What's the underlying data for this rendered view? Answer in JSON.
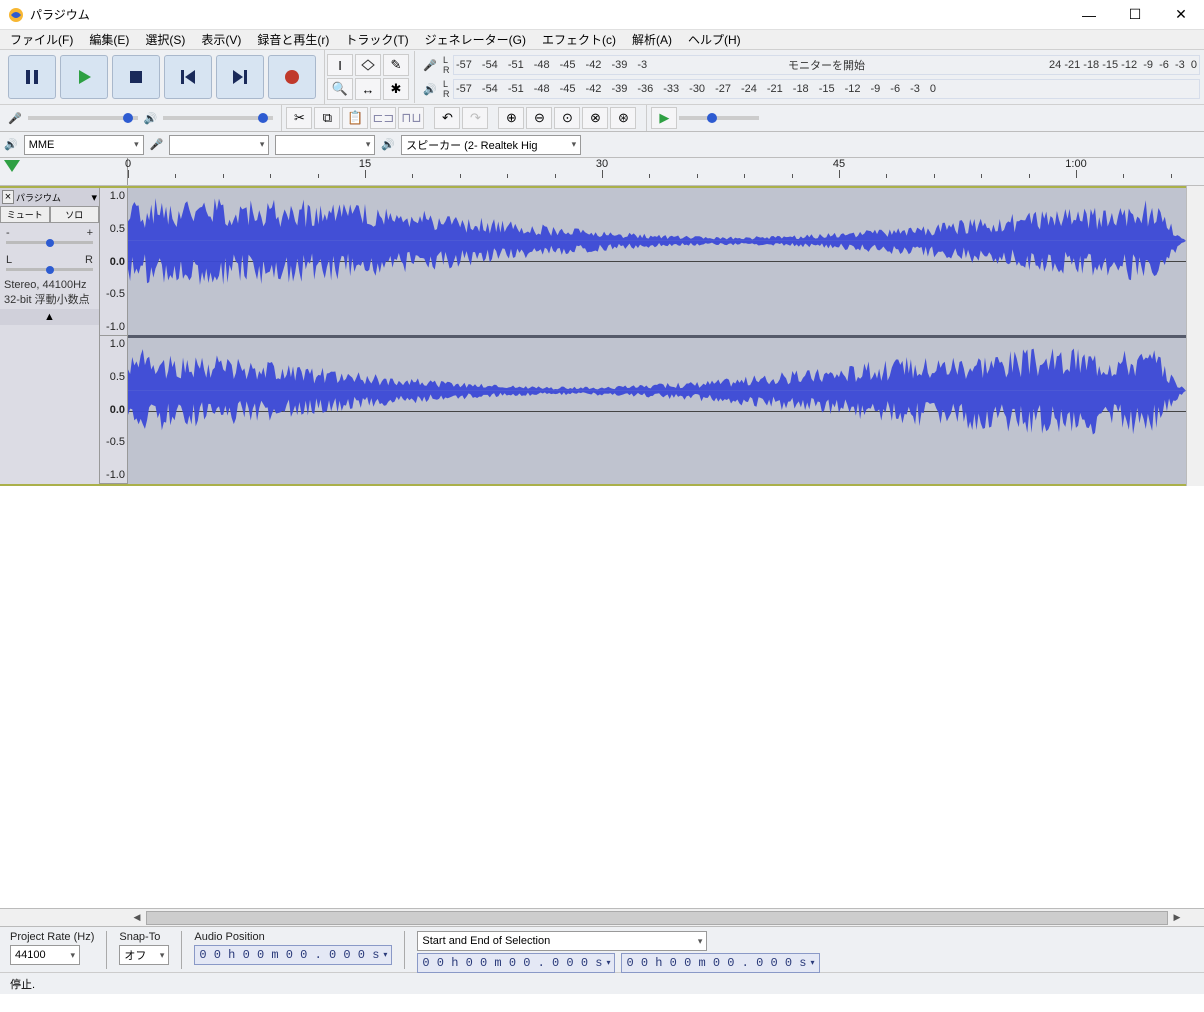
{
  "window": {
    "title": "パラジウム"
  },
  "menu": [
    "ファイル(F)",
    "編集(E)",
    "選択(S)",
    "表示(V)",
    "録音と再生(r)",
    "トラック(T)",
    "ジェネレーター(G)",
    "エフェクト(c)",
    "解析(A)",
    "ヘルプ(H)"
  ],
  "transport_buttons": [
    "pause",
    "play",
    "stop",
    "skip-start",
    "skip-end",
    "record"
  ],
  "tool_buttons": [
    "selection-tool",
    "envelope-tool",
    "draw-tool",
    "zoom-tool",
    "timeshift-tool",
    "multi-tool"
  ],
  "meter": {
    "rec_hint": "モニターを開始",
    "db_ticks": [
      "-57",
      "-54",
      "-51",
      "-48",
      "-45",
      "-42",
      "-39",
      "-36",
      "-33",
      "-30",
      "-27",
      "-24",
      "-21",
      "-18",
      "-15",
      "-12",
      "-9",
      "-6",
      "-3",
      "0"
    ]
  },
  "edit_buttons": [
    "cut",
    "copy",
    "paste",
    "trim",
    "silence",
    "undo",
    "redo",
    "zoom-in",
    "zoom-out",
    "zoom-sel",
    "zoom-fit",
    "zoom-toggle"
  ],
  "device": {
    "host": "MME",
    "input": "",
    "input_channels": "",
    "output": "スピーカー (2- Realtek Hig"
  },
  "timeline": {
    "marks": [
      {
        "pos": 0,
        "label": "0"
      },
      {
        "pos": 237,
        "label": "15"
      },
      {
        "pos": 474,
        "label": "30"
      },
      {
        "pos": 711,
        "label": "45"
      },
      {
        "pos": 948,
        "label": "1:00"
      }
    ]
  },
  "track": {
    "name": "パラジウム",
    "mute": "ミュート",
    "solo": "ソロ",
    "gain_labels": [
      "-",
      "+"
    ],
    "pan_labels": [
      "L",
      "R"
    ],
    "info1": "Stereo, 44100Hz",
    "info2": "32-bit 浮動小数点",
    "amp_labels": [
      "1.0",
      "0.5",
      "0.0",
      "-0.5",
      "-1.0"
    ]
  },
  "selection": {
    "project_rate_label": "Project Rate (Hz)",
    "project_rate": "44100",
    "snap_label": "Snap-To",
    "snap": "オフ",
    "audio_pos_label": "Audio Position",
    "audio_pos": "0 0 h 0 0 m 0 0 . 0 0 0 s",
    "sel_label": "Start and End of Selection",
    "sel_start": "0 0 h 0 0 m 0 0 . 0 0 0 s",
    "sel_end": "0 0 h 0 0 m 0 0 . 0 0 0 s"
  },
  "status": "停止."
}
